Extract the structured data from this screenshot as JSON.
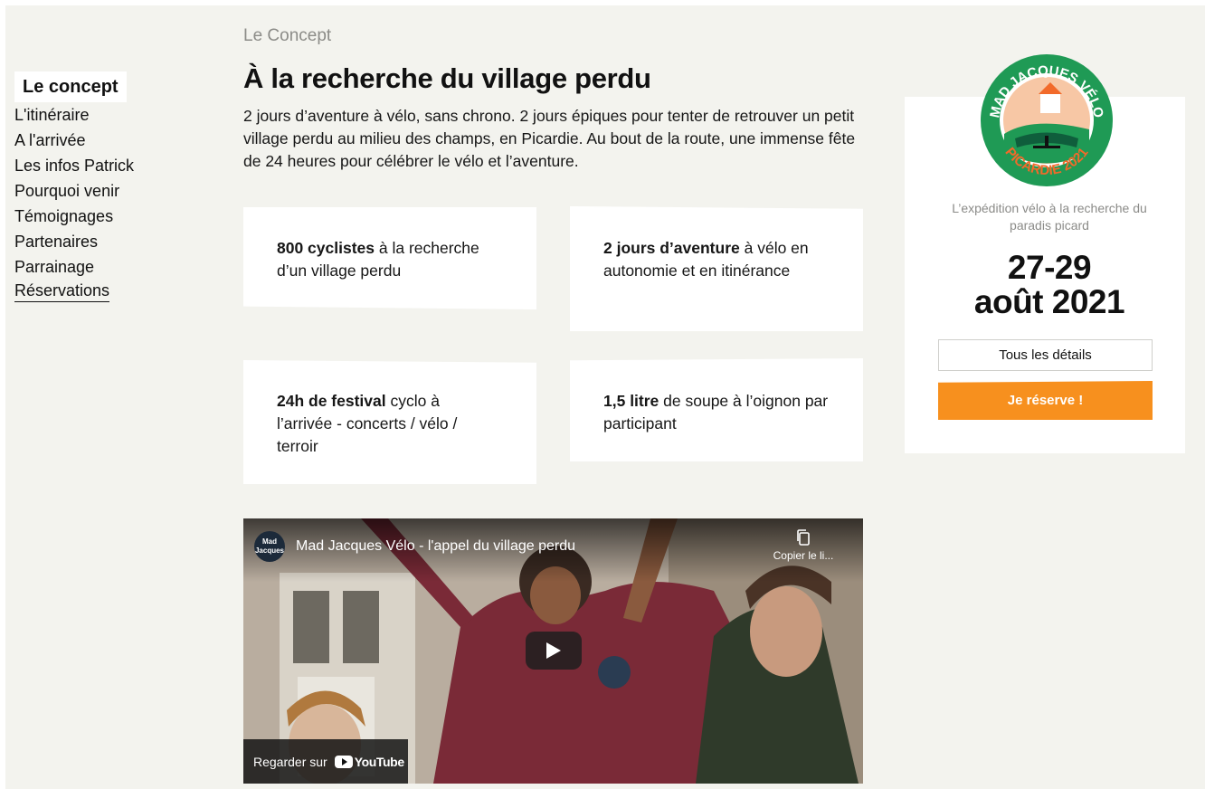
{
  "nav": {
    "items": [
      {
        "label": "Le concept"
      },
      {
        "label": "L'itinéraire"
      },
      {
        "label": "A l'arrivée"
      },
      {
        "label": "Les infos Patrick"
      },
      {
        "label": "Pourquoi venir"
      },
      {
        "label": "Témoignages"
      },
      {
        "label": "Partenaires"
      },
      {
        "label": "Parrainage"
      },
      {
        "label": "Réservations"
      }
    ]
  },
  "main": {
    "breadcrumb": "Le Concept",
    "title": "À la recherche du village perdu",
    "intro": "2 jours d’aventure à vélo, sans chrono. 2 jours épiques pour tenter de retrouver un petit village perdu au milieu des champs, en Picardie. Au bout de la route, une immense fête de 24 heures pour célébrer le vélo et l’aventure.",
    "cards": [
      {
        "bold": "800 cyclistes",
        "rest": " à la recherche d’un village perdu"
      },
      {
        "bold": "2 jours d’aventure",
        "rest": " à vélo en autonomie et en itinérance"
      },
      {
        "bold": "24h de festival",
        "rest": " cyclo à l’arrivée - concerts / vélo / terroir"
      },
      {
        "bold": "1,5 litre",
        "rest": " de soupe à l’oignon par participant"
      }
    ],
    "video": {
      "channel_label": "Mad Jacques",
      "title": "Mad Jacques Vélo - l'appel du village perdu",
      "copy_label": "Copier le li...",
      "watch_label": "Regarder sur",
      "youtube_label": "YouTube"
    }
  },
  "panel": {
    "badge": {
      "top_text": "MAD JACQUES VÉLO",
      "bottom_text": "PICARDIE 2021"
    },
    "tagline": "L’expédition vélo à la recherche du paradis picard",
    "date_line1": "27-29",
    "date_line2": "août 2021",
    "details_label": "Tous les détails",
    "reserve_label": "Je réserve !"
  },
  "colors": {
    "background": "#f3f3ee",
    "accent": "#f7901e",
    "badge_green": "#1f9a55",
    "badge_orange": "#f26a2a"
  }
}
